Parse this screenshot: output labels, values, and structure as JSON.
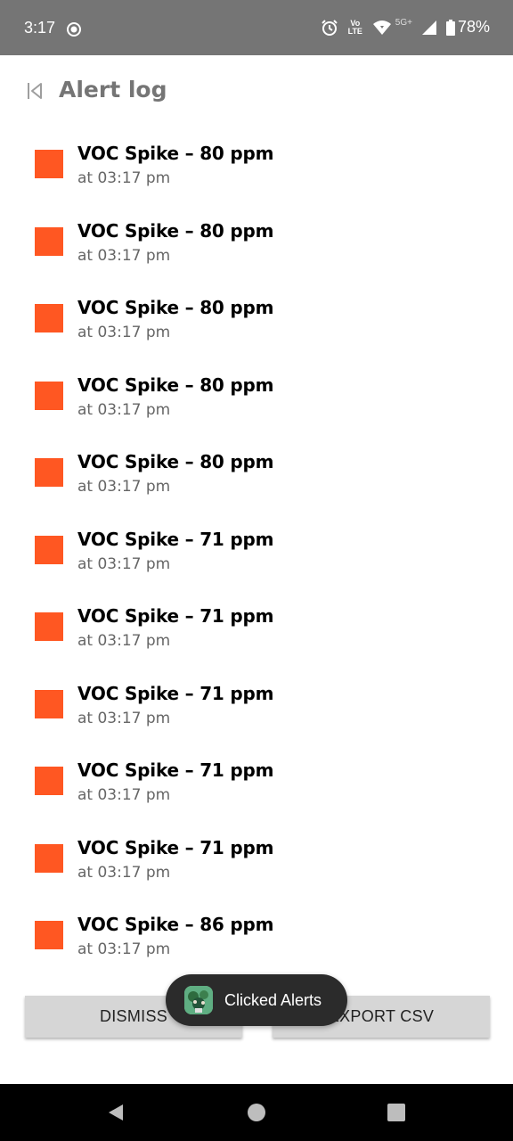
{
  "status_bar": {
    "time": "3:17",
    "network_label": "5G+",
    "volte_label": "Vo LTE",
    "battery_percent": "78%",
    "icons": [
      "screen-record-icon",
      "alarm-icon",
      "volte-icon",
      "wifi-icon",
      "signal-icon",
      "battery-icon"
    ]
  },
  "header": {
    "title": "Alert log",
    "back_icon": "back-icon"
  },
  "alerts": [
    {
      "title": "VOC Spike – 80 ppm",
      "time": "at 03:17 pm"
    },
    {
      "title": "VOC Spike – 80 ppm",
      "time": "at 03:17 pm"
    },
    {
      "title": "VOC Spike – 80 ppm",
      "time": "at 03:17 pm"
    },
    {
      "title": "VOC Spike – 80 ppm",
      "time": "at 03:17 pm"
    },
    {
      "title": "VOC Spike – 80 ppm",
      "time": "at 03:17 pm"
    },
    {
      "title": "VOC Spike – 71 ppm",
      "time": "at 03:17 pm"
    },
    {
      "title": "VOC Spike – 71 ppm",
      "time": "at 03:17 pm"
    },
    {
      "title": "VOC Spike – 71 ppm",
      "time": "at 03:17 pm"
    },
    {
      "title": "VOC Spike – 71 ppm",
      "time": "at 03:17 pm"
    },
    {
      "title": "VOC Spike – 71 ppm",
      "time": "at 03:17 pm"
    },
    {
      "title": "VOC Spike – 86 ppm",
      "time": "at 03:17 pm"
    }
  ],
  "colors": {
    "alert_swatch": "#ff5722",
    "status_bar": "#757575",
    "button_bg": "#d6d6d6",
    "toast_bg": "#2b2b2b"
  },
  "buttons": {
    "dismiss_label": "DISMISS",
    "export_label": "EXPORT CSV"
  },
  "toast": {
    "text": "Clicked Alerts",
    "icon": "app-icon"
  }
}
